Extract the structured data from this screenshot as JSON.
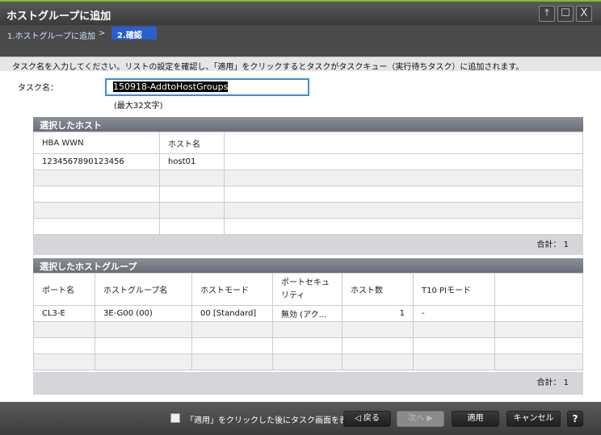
{
  "window": {
    "title": "ホストグループに追加",
    "pin": "⤒",
    "maximize": "☐",
    "close": "X"
  },
  "breadcrumb": {
    "step1": "1.ホストグループに追加",
    "sep": ">",
    "step2": "2.確認"
  },
  "instruction": "タスク名を入力してください。リストの設定を確認し、「適用」をクリックするとタスクがタスクキュー（実行待ちタスク）に追加されます。",
  "task": {
    "label": "タスク名：",
    "value": "150918-AddtoHostGroups",
    "hint": "(最大32文字)"
  },
  "hosts": {
    "title": "選択したホスト",
    "columns": [
      "HBA WWN",
      "ホスト名",
      ""
    ],
    "rows": [
      [
        "1234567890123456",
        "host01",
        ""
      ]
    ],
    "total": "合計：  1"
  },
  "hostgroups": {
    "title": "選択したホストグループ",
    "columns": [
      "ポート名",
      "ホストグループ名",
      "ホストモード",
      "ポートセキュリティ",
      "ホスト数",
      "T10 PIモード",
      ""
    ],
    "rows": [
      [
        "CL3-E",
        "3E-G00 (00)",
        "00 [Standard]",
        "無効 (アク...",
        "1",
        "-",
        ""
      ]
    ],
    "total": "合計：  1"
  },
  "footer": {
    "checkbox_label": "「適用」をクリックした後にタスク画面を表示",
    "back": "◁ 戻る",
    "next": "次へ ▶",
    "apply": "適用",
    "cancel": "キャンセル",
    "help": "?"
  }
}
